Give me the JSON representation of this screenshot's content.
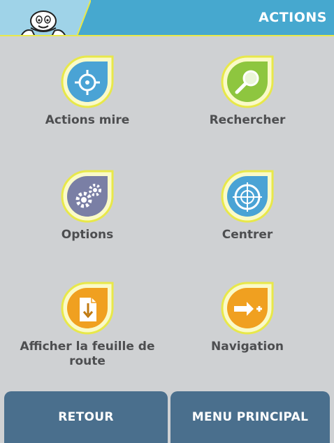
{
  "header": {
    "title": "ACTIONS"
  },
  "tiles": [
    {
      "label": "Actions mire",
      "icon": "crosshair-icon",
      "color": "#4aa3d5"
    },
    {
      "label": "Rechercher",
      "icon": "magnifier-icon",
      "color": "#8ec63f"
    },
    {
      "label": "Options",
      "icon": "gears-icon",
      "color": "#7a7fa5"
    },
    {
      "label": "Centrer",
      "icon": "target-icon",
      "color": "#4aa3d5"
    },
    {
      "label": "Afficher la feuille de route",
      "icon": "roadsheet-icon",
      "color": "#f0a020"
    },
    {
      "label": "Navigation",
      "icon": "arrow-plus-icon",
      "color": "#f0a020"
    }
  ],
  "buttons": {
    "back": "RETOUR",
    "main_menu": "MENU PRINCIPAL"
  },
  "colors": {
    "header": "#46a8cf",
    "accent": "#e8e84a",
    "button": "#4a6f8d",
    "background": "#cfd1d3"
  }
}
